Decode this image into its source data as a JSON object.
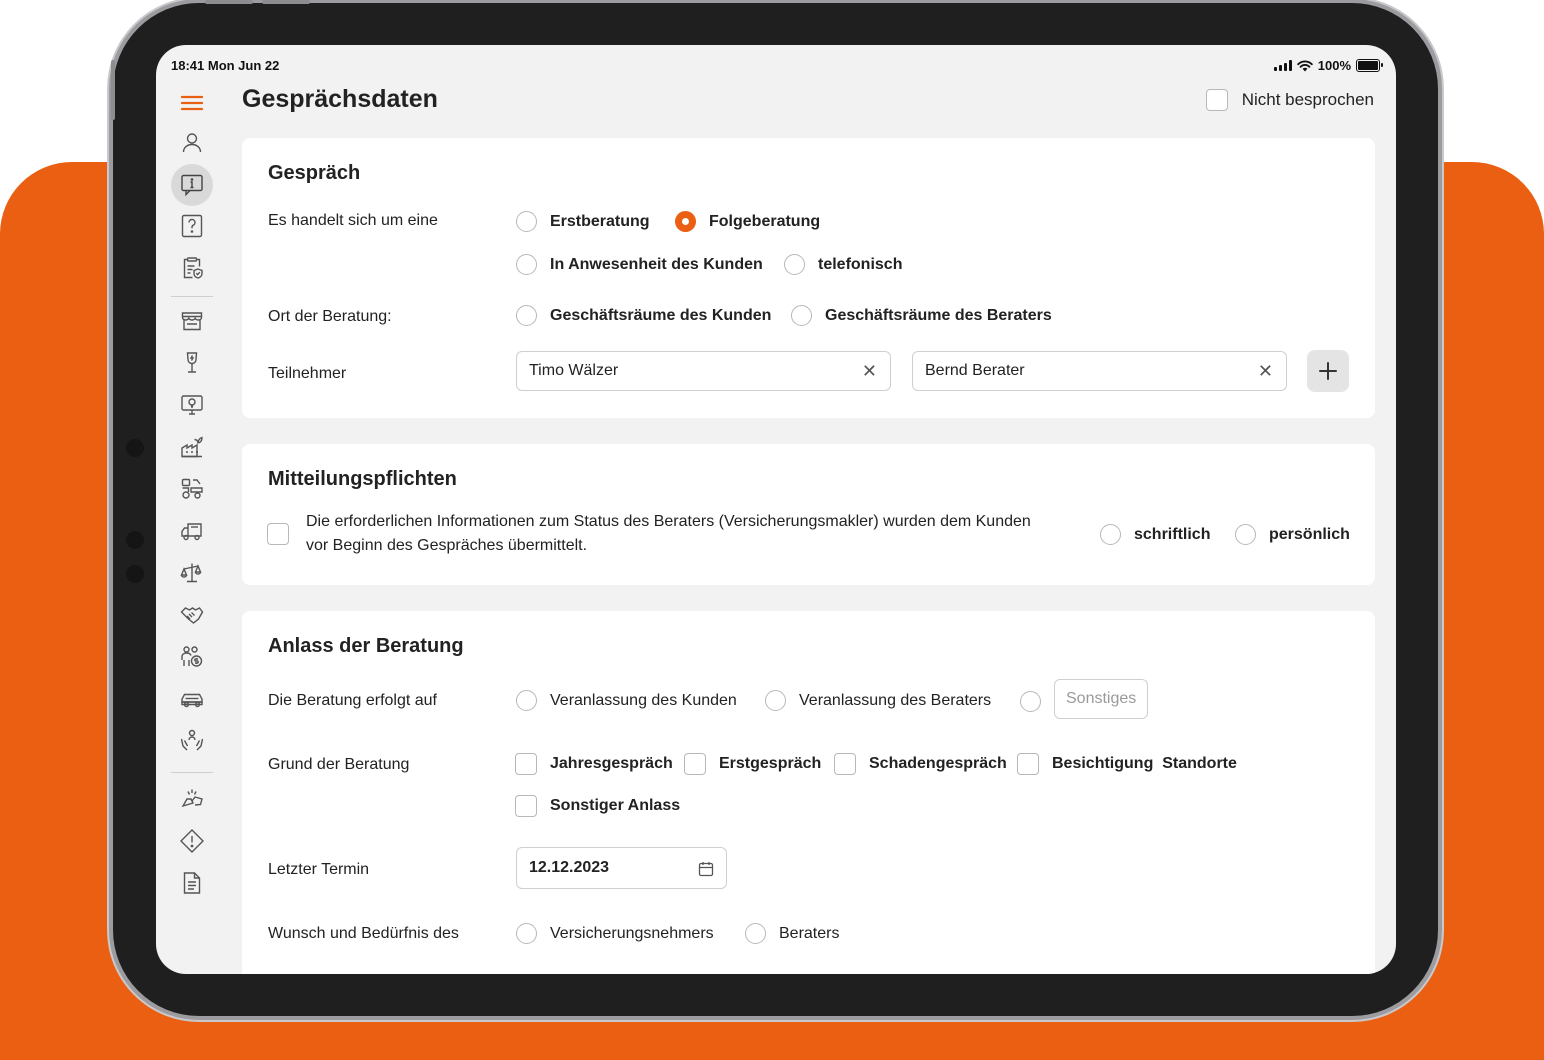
{
  "status_bar": {
    "time": "18:41 Mon Jun 22",
    "battery": "100%"
  },
  "header": {
    "title": "Gesprächsdaten",
    "not_discussed_label": "Nicht besprochen"
  },
  "sidebar": {
    "icons": [
      "menu-icon",
      "person-icon",
      "info-chat-icon",
      "question-icon",
      "clipboard-shield-icon",
      "shop-icon",
      "wine-glass-icon",
      "monitor-idea-icon",
      "factory-plant-icon",
      "machinery-icon",
      "truck-icon",
      "scales-icon",
      "handshake-icon",
      "people-money-icon",
      "car-icon",
      "hands-care-icon",
      "damage-icon",
      "warning-icon",
      "document-icon"
    ]
  },
  "accent_color": "#EA5F12",
  "gespraech": {
    "title": "Gespräch",
    "type_label": "Es handelt sich um eine",
    "type_options": [
      "Erstberatung",
      "Folgeberatung"
    ],
    "type_selected": "Folgeberatung",
    "mode_options": [
      "In Anwesenheit des Kunden",
      "telefonisch"
    ],
    "location_label": "Ort der Beratung:",
    "location_options": [
      "Geschäftsräume des Kunden",
      "Geschäftsräume des Beraters"
    ],
    "participants_label": "Teilnehmer",
    "participants": [
      "Timo Wälzer",
      "Bernd Berater"
    ]
  },
  "mitteilung": {
    "title": "Mitteilungspflichten",
    "text_line1": "Die erforderlichen Informationen zum Status des Beraters (Versicherungsmakler) wurden dem Kunden",
    "text_line2": "vor Beginn des Gespräches  übermittelt.",
    "options": [
      "schriftlich",
      "persönlich"
    ]
  },
  "anlass": {
    "title": "Anlass der Beratung",
    "initiative_label": "Die Beratung erfolgt auf",
    "initiative_options": [
      "Veranlassung des Kunden",
      "Veranlassung des Beraters"
    ],
    "other_placeholder": "Sonstiges",
    "reason_label": "Grund der Beratung",
    "reasons": [
      "Jahresgespräch",
      "Erstgespräch",
      "Schadengespräch",
      "Besichtigung  Standorte",
      "Sonstiger Anlass"
    ],
    "last_date_label": "Letzter Termin",
    "last_date": "12.12.2023",
    "wish_label": "Wunsch und Bedürfnis des",
    "wish_options": [
      "Versicherungsnehmers",
      "Beraters"
    ]
  }
}
